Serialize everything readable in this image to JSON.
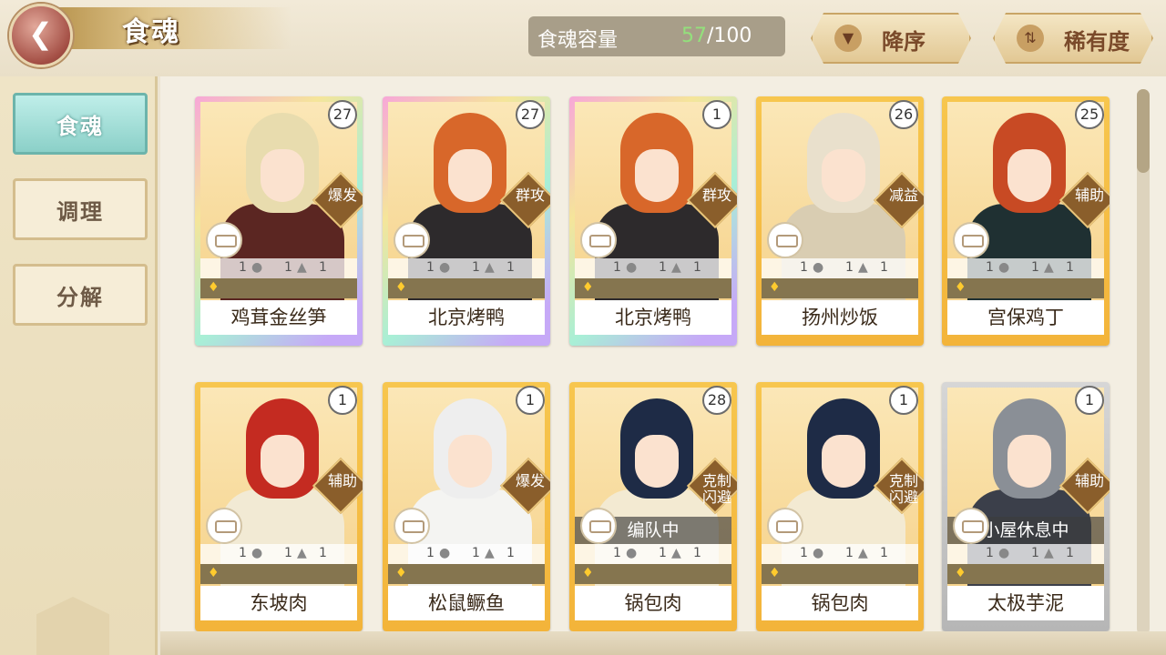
{
  "header": {
    "title": "食魂",
    "capacity_label": "食魂容量",
    "capacity_current": "57",
    "capacity_max": "/100",
    "sort_order_label": "降序",
    "sort_key_label": "稀有度"
  },
  "sidebar": {
    "items": [
      {
        "label": "食魂"
      },
      {
        "label": "调理"
      },
      {
        "label": "分解"
      }
    ]
  },
  "cards": [
    {
      "name": "鸡茸金丝笋",
      "level": "27",
      "role": "爆发",
      "status": "",
      "stats": [
        "1",
        "1",
        "1"
      ],
      "frame": "rainbow",
      "hair": "#e8dcae",
      "outfit": "#5b2622"
    },
    {
      "name": "北京烤鸭",
      "level": "27",
      "role": "群攻",
      "status": "",
      "stats": [
        "1",
        "1",
        "1"
      ],
      "frame": "rainbow",
      "hair": "#d8672a",
      "outfit": "#2d2a2c"
    },
    {
      "name": "北京烤鸭",
      "level": "1",
      "role": "群攻",
      "status": "",
      "stats": [
        "1",
        "1",
        "1"
      ],
      "frame": "rainbow",
      "hair": "#d8672a",
      "outfit": "#2d2a2c"
    },
    {
      "name": "扬州炒饭",
      "level": "26",
      "role": "减益",
      "status": "",
      "stats": [
        "1",
        "1",
        "1"
      ],
      "frame": "gold",
      "hair": "#e9e0cc",
      "outfit": "#d9cdb2"
    },
    {
      "name": "宫保鸡丁",
      "level": "25",
      "role": "辅助",
      "status": "",
      "stats": [
        "1",
        "1",
        "1"
      ],
      "frame": "gold",
      "hair": "#c84a24",
      "outfit": "#1f3032"
    },
    {
      "name": "东坡肉",
      "level": "1",
      "role": "辅助",
      "status": "",
      "stats": [
        "1",
        "1",
        "1"
      ],
      "frame": "gold",
      "hair": "#c42b21",
      "outfit": "#f2ead4"
    },
    {
      "name": "松鼠鳜鱼",
      "level": "1",
      "role": "爆发",
      "status": "",
      "stats": [
        "1",
        "1",
        "1"
      ],
      "frame": "gold",
      "hair": "#eeeeee",
      "outfit": "#f4f4f2"
    },
    {
      "name": "锅包肉",
      "level": "28",
      "role": "克制\n闪避",
      "status": "编队中",
      "stats": [
        "1",
        "1",
        "1"
      ],
      "frame": "gold",
      "hair": "#1e2b46",
      "outfit": "#f3ead2"
    },
    {
      "name": "锅包肉",
      "level": "1",
      "role": "克制\n闪避",
      "status": "",
      "stats": [
        "1",
        "1",
        "1"
      ],
      "frame": "gold",
      "hair": "#1e2b46",
      "outfit": "#f3ead2"
    },
    {
      "name": "太极芋泥",
      "level": "1",
      "role": "辅助",
      "status": "小屋休息中",
      "stats": [
        "1",
        "1",
        "1"
      ],
      "frame": "silver",
      "hair": "#8a8f96",
      "outfit": "#3b3f4a"
    }
  ]
}
